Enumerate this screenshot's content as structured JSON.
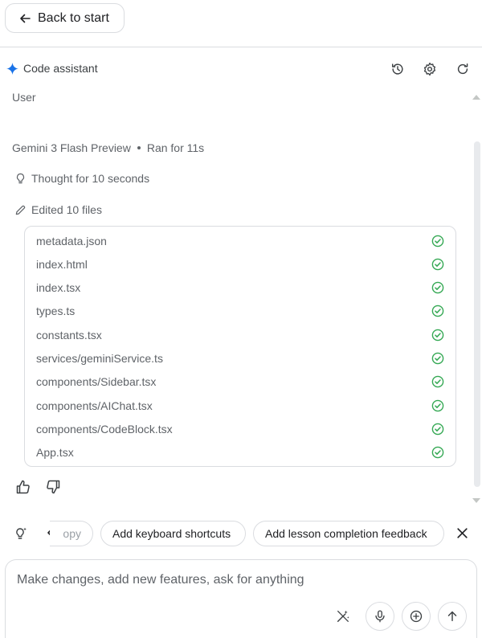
{
  "topbar": {
    "back_label": "Back to start"
  },
  "header": {
    "title": "Code assistant",
    "icons": [
      "history-icon",
      "settings-icon",
      "refresh-icon"
    ]
  },
  "conversation": {
    "user_label": "User",
    "model_name": "Gemini 3 Flash Preview",
    "ran_for": "Ran for 11s",
    "thought": "Thought for 10 seconds",
    "edited": "Edited 10 files",
    "files": [
      "metadata.json",
      "index.html",
      "index.tsx",
      "types.ts",
      "constants.tsx",
      "services/geminiService.ts",
      "components/Sidebar.tsx",
      "components/AIChat.tsx",
      "components/CodeBlock.tsx",
      "App.tsx"
    ]
  },
  "suggestions": {
    "chips": [
      "opy",
      "Add keyboard shortcuts",
      "Add lesson completion feedback"
    ]
  },
  "composer": {
    "placeholder": "Make changes, add new features, ask for anything"
  },
  "colors": {
    "accent_blue": "#1a73e8",
    "success_green": "#34a853",
    "border": "#dadce0",
    "text_secondary": "#5f6368"
  }
}
